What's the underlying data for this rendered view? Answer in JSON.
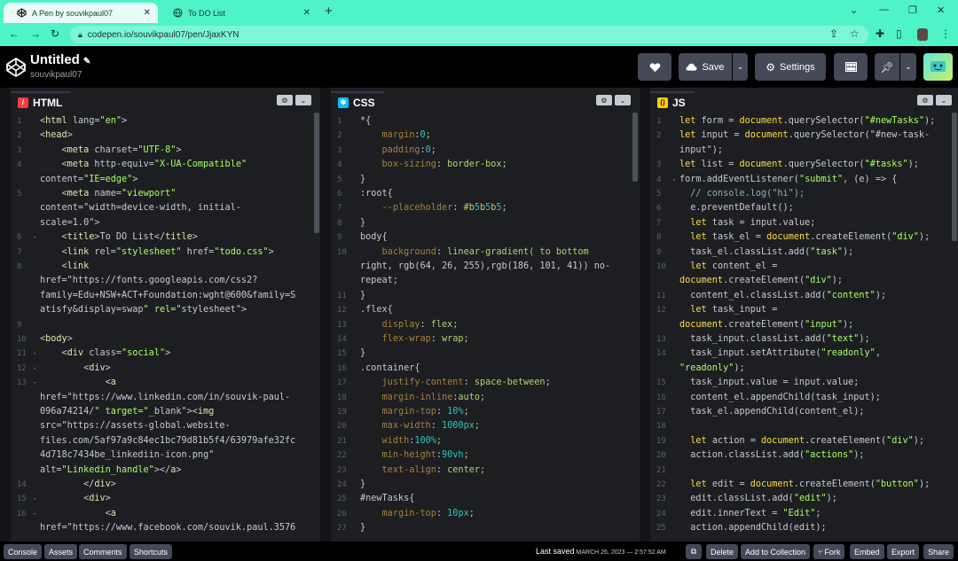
{
  "browser": {
    "tabs": [
      {
        "label": "A Pen by souvikpaul07"
      },
      {
        "label": "To DO List"
      }
    ],
    "url": "codepen.io/souvikpaul07/pen/JjaxKYN"
  },
  "header": {
    "title": "Untitled",
    "author": "souvikpaul07",
    "save_label": "Save",
    "settings_label": "Settings"
  },
  "panes": {
    "html_label": "HTML",
    "css_label": "CSS",
    "js_label": "JS"
  },
  "html_lines": [
    {
      "n": "1",
      "t": "<html lang=\"en\">"
    },
    {
      "n": "2",
      "t": "<head>"
    },
    {
      "n": "3",
      "t": "    <meta charset=\"UTF-8\">"
    },
    {
      "n": "4",
      "t": "    <meta http-equiv=\"X-UA-Compatible\""
    },
    {
      "n": "",
      "t": "content=\"IE=edge\">"
    },
    {
      "n": "5",
      "t": "    <meta name=\"viewport\""
    },
    {
      "n": "",
      "t": "content=\"width=device-width, initial-"
    },
    {
      "n": "",
      "t": "scale=1.0\">"
    },
    {
      "n": "6",
      "t": "    <title>To DO List</title>"
    },
    {
      "n": "7",
      "t": "    <link rel=\"stylesheet\" href=\"todo.css\">"
    },
    {
      "n": "8",
      "t": "    <link"
    },
    {
      "n": "",
      "t": "href=\"https://fonts.googleapis.com/css2?"
    },
    {
      "n": "",
      "t": "family=Edu+NSW+ACT+Foundation:wght@600&family=S"
    },
    {
      "n": "",
      "t": "atisfy&display=swap\" rel=\"stylesheet\">"
    },
    {
      "n": "9",
      "t": ""
    },
    {
      "n": "10",
      "t": "<body>"
    },
    {
      "n": "11",
      "t": "    <div class=\"social\">"
    },
    {
      "n": "12",
      "t": "        <div>"
    },
    {
      "n": "13",
      "t": "            <a"
    },
    {
      "n": "",
      "t": "href=\"https://www.linkedin.com/in/souvik-paul-"
    },
    {
      "n": "",
      "t": "096a74214/\" target=\"_blank\"><img"
    },
    {
      "n": "",
      "t": "src=\"https://assets-global.website-"
    },
    {
      "n": "",
      "t": "files.com/5af97a9c84ec1bc79d81b5f4/63979afe32fc"
    },
    {
      "n": "",
      "t": "4d718c7434be_linkediin-icon.png\""
    },
    {
      "n": "",
      "t": "alt=\"Linkedin_handle\"></a>"
    },
    {
      "n": "14",
      "t": "        </div>"
    },
    {
      "n": "15",
      "t": "        <div>"
    },
    {
      "n": "16",
      "t": "            <a"
    },
    {
      "n": "",
      "t": "href=\"https://www.facebook.com/souvik.paul.3576"
    }
  ],
  "css_lines": [
    {
      "n": "1",
      "t": "*{"
    },
    {
      "n": "2",
      "t": "    margin:0;"
    },
    {
      "n": "3",
      "t": "    padding:0;"
    },
    {
      "n": "4",
      "t": "    box-sizing: border-box;"
    },
    {
      "n": "5",
      "t": "}"
    },
    {
      "n": "6",
      "t": ":root{"
    },
    {
      "n": "7",
      "t": "    --placeholder: #b5b5b5;"
    },
    {
      "n": "8",
      "t": "}"
    },
    {
      "n": "9",
      "t": "body{"
    },
    {
      "n": "10",
      "t": "    background: linear-gradient( to bottom"
    },
    {
      "n": "",
      "t": "right, rgb(64, 26, 255),rgb(186, 101, 41)) no-"
    },
    {
      "n": "",
      "t": "repeat;"
    },
    {
      "n": "11",
      "t": "}"
    },
    {
      "n": "12",
      "t": ".flex{"
    },
    {
      "n": "13",
      "t": "    display: flex;"
    },
    {
      "n": "14",
      "t": "    flex-wrap: wrap;"
    },
    {
      "n": "15",
      "t": "}"
    },
    {
      "n": "16",
      "t": ".container{"
    },
    {
      "n": "17",
      "t": "    justify-content: space-between;"
    },
    {
      "n": "18",
      "t": "    margin-inline:auto;"
    },
    {
      "n": "19",
      "t": "    margin-top: 10%;"
    },
    {
      "n": "20",
      "t": "    max-width: 1000px;"
    },
    {
      "n": "21",
      "t": "    width:100%;"
    },
    {
      "n": "22",
      "t": "    min-height:90vh;"
    },
    {
      "n": "23",
      "t": "    text-align: center;"
    },
    {
      "n": "24",
      "t": "}"
    },
    {
      "n": "25",
      "t": "#newTasks{"
    },
    {
      "n": "26",
      "t": "    margin-top: 10px;"
    },
    {
      "n": "27",
      "t": "}"
    }
  ],
  "js_lines": [
    {
      "n": "1",
      "t": "let form = document.querySelector(\"#newTasks\");"
    },
    {
      "n": "2",
      "t": "let input = document.querySelector(\"#new-task-"
    },
    {
      "n": "",
      "t": "input\");"
    },
    {
      "n": "3",
      "t": "let list = document.querySelector(\"#tasks\");"
    },
    {
      "n": "4",
      "t": "form.addEventListener(\"submit\", (e) => {"
    },
    {
      "n": "5",
      "t": "  // console.log(\"hi\");"
    },
    {
      "n": "6",
      "t": "  e.preventDefault();"
    },
    {
      "n": "7",
      "t": "  let task = input.value;"
    },
    {
      "n": "8",
      "t": "  let task_el = document.createElement(\"div\");"
    },
    {
      "n": "9",
      "t": "  task_el.classList.add(\"task\");"
    },
    {
      "n": "10",
      "t": "  let content_el ="
    },
    {
      "n": "",
      "t": "document.createElement(\"div\");"
    },
    {
      "n": "11",
      "t": "  content_el.classList.add(\"content\");"
    },
    {
      "n": "12",
      "t": "  let task_input ="
    },
    {
      "n": "",
      "t": "document.createElement(\"input\");"
    },
    {
      "n": "13",
      "t": "  task_input.classList.add(\"text\");"
    },
    {
      "n": "14",
      "t": "  task_input.setAttribute(\"readonly\","
    },
    {
      "n": "",
      "t": "\"readonly\");"
    },
    {
      "n": "15",
      "t": "  task_input.value = input.value;"
    },
    {
      "n": "16",
      "t": "  content_el.appendChild(task_input);"
    },
    {
      "n": "17",
      "t": "  task_el.appendChild(content_el);"
    },
    {
      "n": "18",
      "t": ""
    },
    {
      "n": "19",
      "t": "  let action = document.createElement(\"div\");"
    },
    {
      "n": "20",
      "t": "  action.classList.add(\"actions\");"
    },
    {
      "n": "21",
      "t": ""
    },
    {
      "n": "22",
      "t": "  let edit = document.createElement(\"button\");"
    },
    {
      "n": "23",
      "t": "  edit.classList.add(\"edit\");"
    },
    {
      "n": "24",
      "t": "  edit.innerText = \"Edit\";"
    },
    {
      "n": "25",
      "t": "  action.appendChild(edit);"
    }
  ],
  "bottom": {
    "console": "Console",
    "assets": "Assets",
    "comments": "Comments",
    "shortcuts": "Shortcuts",
    "last_saved_label": "Last saved",
    "last_saved_date": "MARCH 26, 2023 — 2:57:52 AM",
    "delete": "Delete",
    "add_collection": "Add to Collection",
    "fork": "Fork",
    "embed": "Embed",
    "export": "Export",
    "share": "Share"
  },
  "colors": {
    "browser_accent": "#4ef3c7",
    "editor_bg": "#1d1e22",
    "button_bg": "#444857"
  }
}
